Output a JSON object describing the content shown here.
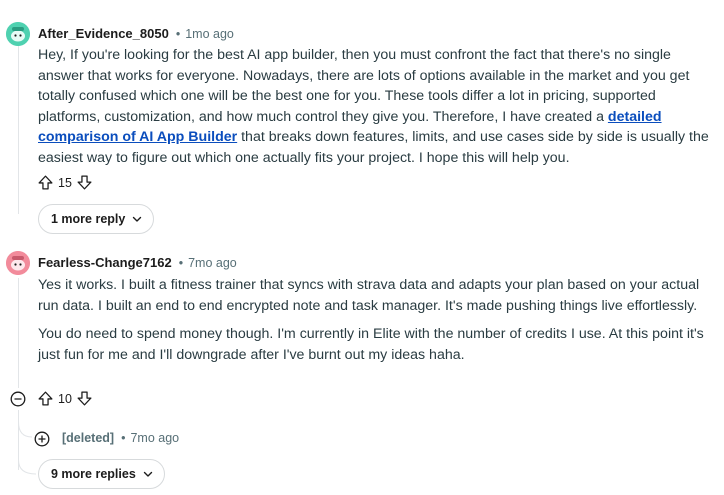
{
  "comments": [
    {
      "author": "After_Evidence_8050",
      "time": "1mo ago",
      "body_parts": [
        "Hey, If you're looking for the best AI app builder, then you must confront the fact that there's no single answer that works for everyone. Nowadays, there are lots of options available in the market and you get totally confused which one will be the best one for you. These tools differ a lot in pricing, supported platforms, customization, and how much control they give you. Therefore, I have created a ",
        "detailed comparison of AI App Builder",
        " that breaks down features, limits, and use cases side by side is usually the easiest way to figure out which one actually fits your project. I hope this will help you."
      ],
      "votes": "15",
      "more_label": "1 more reply"
    },
    {
      "author": "Fearless-Change7162",
      "time": "7mo ago",
      "paragraphs": [
        "Yes it works. I built a fitness trainer that syncs with strava data and adapts your plan based on your actual run data. I built an end to end encrypted note and task manager. It's made pushing things live effortlessly.",
        "You do need to spend money though. I'm currently in Elite with the number of credits I use. At this point it's just fun for me and I'll downgrade after I've burnt out my ideas haha."
      ],
      "votes": "10",
      "reply": {
        "author": "[deleted]",
        "time": "7mo ago"
      },
      "more_label": "9 more replies"
    }
  ],
  "separator": "•",
  "icons": {
    "upvote": "arrow-up-icon",
    "downvote": "arrow-down-icon",
    "collapse": "minus-circle-icon",
    "expand": "plus-circle-icon",
    "chevron": "chevron-down-icon"
  },
  "colors": {
    "link": "#0a4dbd",
    "meta": "#576f76",
    "thread": "#e2e5e8",
    "avatar1": "#4fd1b0",
    "avatar2": "#f28b9b"
  }
}
